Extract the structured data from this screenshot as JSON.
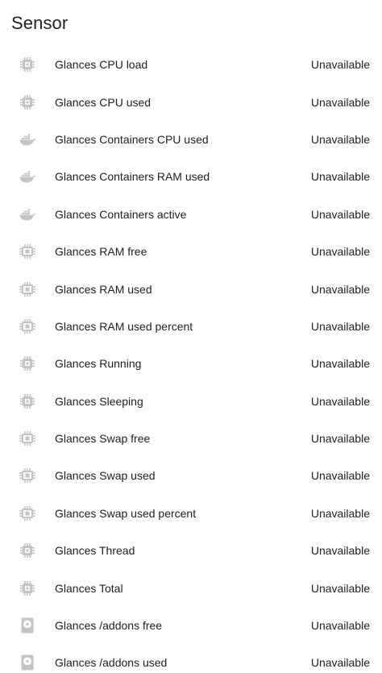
{
  "card": {
    "title": "Sensor"
  },
  "colors": {
    "icon": "#c4c4c4",
    "text": "#212121",
    "background": "#ffffff"
  },
  "rows": [
    {
      "name": "Glances CPU load",
      "state": "Unavailable",
      "icon": "chip-icon"
    },
    {
      "name": "Glances CPU used",
      "state": "Unavailable",
      "icon": "chip-icon"
    },
    {
      "name": "Glances Containers CPU used",
      "state": "Unavailable",
      "icon": "docker-icon"
    },
    {
      "name": "Glances Containers RAM used",
      "state": "Unavailable",
      "icon": "docker-icon"
    },
    {
      "name": "Glances Containers active",
      "state": "Unavailable",
      "icon": "docker-icon"
    },
    {
      "name": "Glances RAM free",
      "state": "Unavailable",
      "icon": "memory-icon"
    },
    {
      "name": "Glances RAM used",
      "state": "Unavailable",
      "icon": "memory-icon"
    },
    {
      "name": "Glances RAM used percent",
      "state": "Unavailable",
      "icon": "memory-icon"
    },
    {
      "name": "Glances Running",
      "state": "Unavailable",
      "icon": "chip-icon"
    },
    {
      "name": "Glances Sleeping",
      "state": "Unavailable",
      "icon": "chip-icon"
    },
    {
      "name": "Glances Swap free",
      "state": "Unavailable",
      "icon": "memory-icon"
    },
    {
      "name": "Glances Swap used",
      "state": "Unavailable",
      "icon": "memory-icon"
    },
    {
      "name": "Glances Swap used percent",
      "state": "Unavailable",
      "icon": "memory-icon"
    },
    {
      "name": "Glances Thread",
      "state": "Unavailable",
      "icon": "chip-icon"
    },
    {
      "name": "Glances Total",
      "state": "Unavailable",
      "icon": "chip-icon"
    },
    {
      "name": "Glances /addons free",
      "state": "Unavailable",
      "icon": "harddisk-icon"
    },
    {
      "name": "Glances /addons used",
      "state": "Unavailable",
      "icon": "harddisk-icon"
    }
  ]
}
